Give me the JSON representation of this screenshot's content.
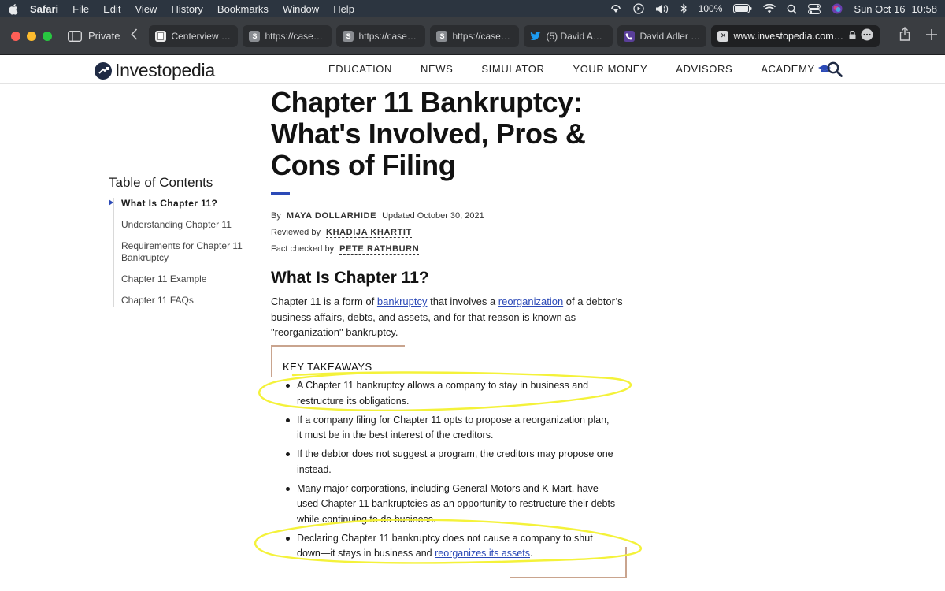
{
  "menubar": {
    "app": "Safari",
    "items": [
      "File",
      "Edit",
      "View",
      "History",
      "Bookmarks",
      "Window",
      "Help"
    ],
    "battery": "100%",
    "date": "Sun Oct 16",
    "time": "10:58"
  },
  "toolbar": {
    "private_label": "Private",
    "tabs": [
      {
        "title": "Centerview P...",
        "favicon": "doc-icon"
      },
      {
        "title": "https://cases....",
        "favicon": "S"
      },
      {
        "title": "https://cases....",
        "favicon": "S"
      },
      {
        "title": "https://cases....",
        "favicon": "S"
      },
      {
        "title": "(5) David Adle...",
        "favicon": "twitter-icon"
      },
      {
        "title": "David Adler |...",
        "favicon": "phone-icon"
      }
    ],
    "active_tab": {
      "url": "www.investopedia.com/te"
    }
  },
  "site": {
    "logo": "Investopedia",
    "nav": [
      "EDUCATION",
      "NEWS",
      "SIMULATOR",
      "YOUR MONEY",
      "ADVISORS",
      "ACADEMY"
    ]
  },
  "toc": {
    "title": "Table of Contents",
    "items": [
      "What Is Chapter 11?",
      "Understanding Chapter 11",
      "Requirements for Chapter 11 Bankruptcy",
      "Chapter 11 Example",
      "Chapter 11 FAQs"
    ]
  },
  "article": {
    "title": "Chapter 11 Bankruptcy: What's Involved, Pros & Cons of Filing",
    "by_label": "By",
    "author": "MAYA DOLLARHIDE",
    "updated": "Updated October 30, 2021",
    "reviewed_label": "Reviewed by",
    "reviewer": "KHADIJA KHARTIT",
    "fact_label": "Fact checked by",
    "fact_checker": "PETE RATHBURN",
    "section_title": "What Is Chapter 11?",
    "para": {
      "p1": "Chapter 11 is a form of ",
      "link1": "bankruptcy",
      "p2": " that involves a ",
      "link2": "reorganization",
      "p3": " of a debtor’s business affairs, debts, and assets, and for that reason is known as \"reorganization\" bankruptcy."
    }
  },
  "takeaways": {
    "heading": "KEY TAKEAWAYS",
    "items": [
      "A Chapter 11 bankruptcy allows a company to stay in business and restructure its obligations.",
      "If a company filing for Chapter 11 opts to propose a reorganization plan, it must be in the best interest of the creditors.",
      "If the debtor does not suggest a program, the creditors may propose one instead.",
      "Many major corporations, including General Motors and K-Mart, have used Chapter 11 bankruptcies as an opportunity to restructure their debts while continuing to do business."
    ],
    "last_item_text": "Declaring Chapter 11 bankruptcy does not cause a company to shut down—it stays in business and ",
    "last_item_link": "reorganizes its assets",
    "last_item_end": "."
  },
  "colors": {
    "accent": "#2c4ab7",
    "highlight": "#f4f23a",
    "box_border": "#c9a48e"
  }
}
